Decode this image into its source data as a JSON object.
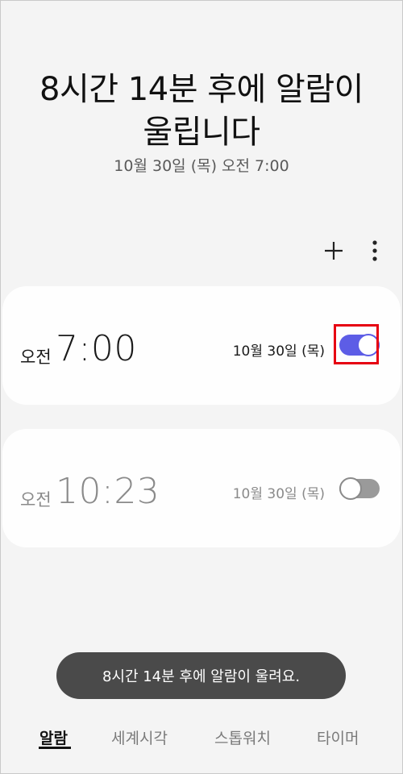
{
  "header": {
    "headline_line1": "8시간 14분 후에 알람이",
    "headline_line2": "울립니다",
    "next_alarm": "10월 30일 (목) 오전 7:00"
  },
  "toolbar": {
    "add_icon": "plus-icon",
    "more_icon": "more-vertical-icon"
  },
  "alarms": [
    {
      "ampm": "오전",
      "time": "7:00",
      "date": "10월 30일 (목)",
      "enabled": true
    },
    {
      "ampm": "오전",
      "time": "10:23",
      "date": "10월 30일 (목)",
      "enabled": false
    }
  ],
  "toast": {
    "text": "8시간 14분 후에 알람이 울려요."
  },
  "tabs": [
    {
      "label": "알람",
      "active": true
    },
    {
      "label": "세계시각",
      "active": false
    },
    {
      "label": "스톱워치",
      "active": false
    },
    {
      "label": "타이머",
      "active": false
    }
  ],
  "colors": {
    "accent": "#5d5de6",
    "highlight": "#e60012",
    "toast_bg": "#4a4a4a"
  }
}
